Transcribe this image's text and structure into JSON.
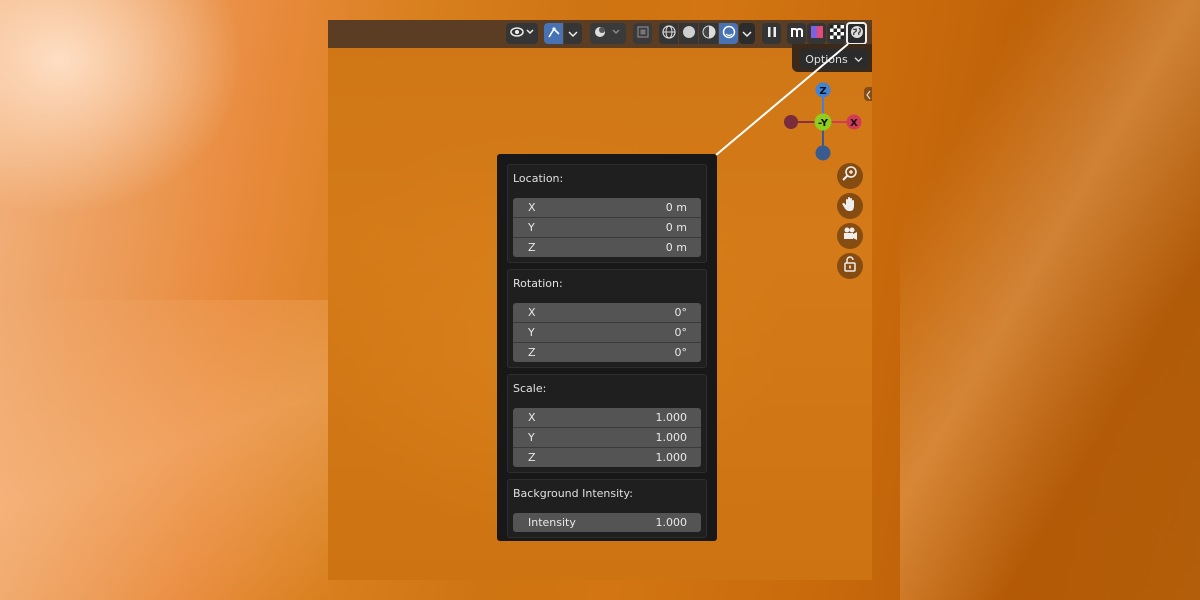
{
  "header": {
    "options_label": "Options",
    "icons": [
      "visibility-icon",
      "gizmo-icon",
      "overlay-icon",
      "xray-icon",
      "wireframe-shading-icon",
      "solid-shading-icon",
      "material-shading-icon",
      "rendered-shading-icon",
      "pause-icon",
      "m-icon",
      "color-icon",
      "checker-icon",
      "world-icon"
    ]
  },
  "gizmo": {
    "z_label": "Z",
    "y_label": "-Y",
    "x_label": "X"
  },
  "panel": {
    "location": {
      "title": "Location:",
      "fields": [
        {
          "label": "X",
          "value": "0 m"
        },
        {
          "label": "Y",
          "value": "0 m"
        },
        {
          "label": "Z",
          "value": "0 m"
        }
      ]
    },
    "rotation": {
      "title": "Rotation:",
      "fields": [
        {
          "label": "X",
          "value": "0°"
        },
        {
          "label": "Y",
          "value": "0°"
        },
        {
          "label": "Z",
          "value": "0°"
        }
      ]
    },
    "scale": {
      "title": "Scale:",
      "fields": [
        {
          "label": "X",
          "value": "1.000"
        },
        {
          "label": "Y",
          "value": "1.000"
        },
        {
          "label": "Z",
          "value": "1.000"
        }
      ]
    },
    "background": {
      "title": "Background Intensity:",
      "fields": [
        {
          "label": "Intensity",
          "value": "1.000"
        }
      ]
    }
  },
  "colors": {
    "accent": "#4772b3",
    "x_axis": "#d23a55",
    "y_axis": "#8fce1f",
    "z_axis": "#3f84d8"
  }
}
